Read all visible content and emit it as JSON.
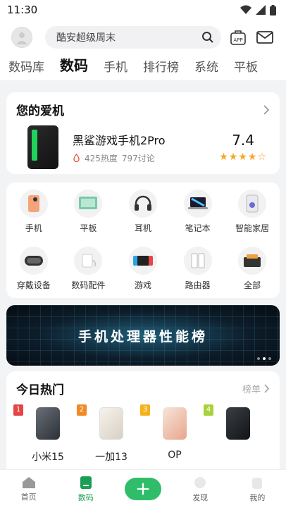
{
  "status": {
    "time": "11:30"
  },
  "search": {
    "placeholder": "酷安超级周末"
  },
  "top_icons": {
    "app": "APP"
  },
  "tabs": [
    "数码库",
    "数码",
    "手机",
    "排行榜",
    "系统",
    "平板"
  ],
  "favorite": {
    "title": "您的爱机",
    "device": "黑鲨游戏手机2Pro",
    "heat": "425热度",
    "discussions": "797讨论",
    "score": "7.4",
    "stars": "★★★★☆",
    "rating": 3.5
  },
  "categories": [
    {
      "label": "手机",
      "icon": "phone-icon"
    },
    {
      "label": "平板",
      "icon": "tablet-icon"
    },
    {
      "label": "耳机",
      "icon": "headphones-icon"
    },
    {
      "label": "笔记本",
      "icon": "laptop-icon"
    },
    {
      "label": "智能家居",
      "icon": "smart-home-icon"
    },
    {
      "label": "穿戴设备",
      "icon": "wearable-icon"
    },
    {
      "label": "数码配件",
      "icon": "accessory-icon"
    },
    {
      "label": "游戏",
      "icon": "game-icon"
    },
    {
      "label": "路由器",
      "icon": "router-icon"
    },
    {
      "label": "全部",
      "icon": "all-icon"
    }
  ],
  "banner": {
    "text": "手机处理器性能榜"
  },
  "hot": {
    "title": "今日热门",
    "more": "榜单",
    "items": [
      {
        "rank": "1",
        "name": "小米15",
        "color": "#e54545"
      },
      {
        "rank": "2",
        "name": "一加13",
        "color": "#f08a24"
      },
      {
        "rank": "3",
        "name": "OP",
        "color": "#f5b21f"
      },
      {
        "rank": "4",
        "name": "",
        "color": "#a8d23a"
      }
    ]
  },
  "bottom_nav": {
    "home": "首页",
    "digital": "数码",
    "discover": "发现",
    "mine": "我的"
  },
  "colors": {
    "accent": "#2fbd6a",
    "star": "#f5a623"
  }
}
